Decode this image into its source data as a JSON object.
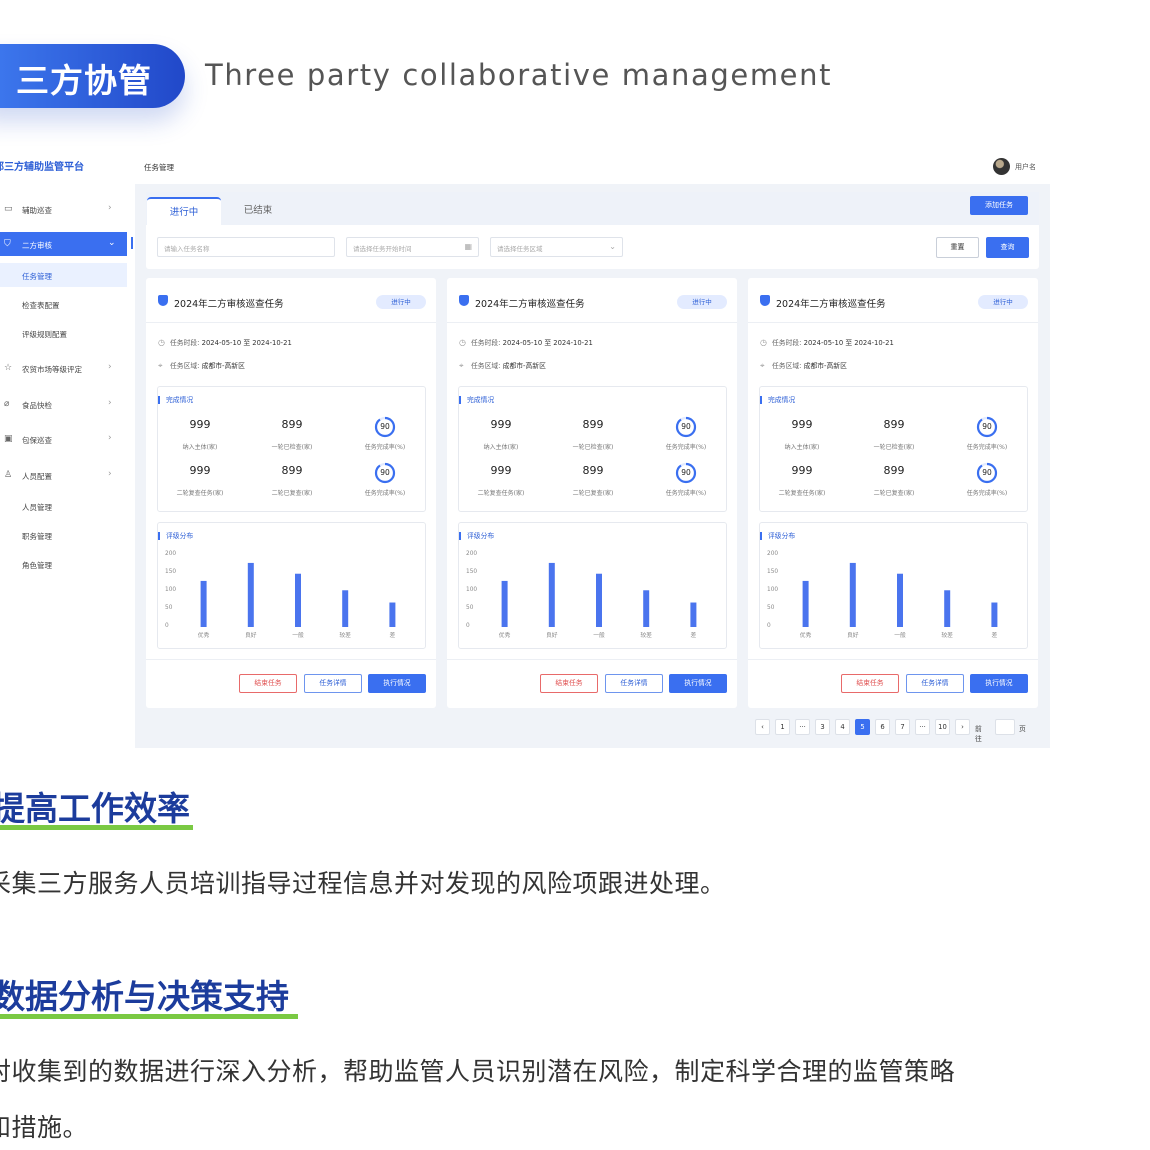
{
  "banner": {
    "title": "三方协管",
    "subtitle": "Three party collaborative management"
  },
  "sidebar": {
    "title": "郭三方辅助监管平台",
    "items": [
      {
        "label": "辅助巡查",
        "icon": "calendar-icon"
      },
      {
        "label": "二方审核",
        "icon": "shield-icon",
        "active": true
      },
      {
        "label": "农贸市场等级评定",
        "icon": "star-icon"
      },
      {
        "label": "食品快检",
        "icon": "flask-icon"
      },
      {
        "label": "包保巡查",
        "icon": "clipboard-icon"
      },
      {
        "label": "人员配置",
        "icon": "user-icon"
      }
    ],
    "sub_review": [
      "任务管理",
      "检查表配置",
      "评级规则配置"
    ],
    "sub_staff": [
      "人员管理",
      "职务管理",
      "角色管理"
    ]
  },
  "topbar": {
    "breadcrumb": "任务管理",
    "username": "用户名"
  },
  "filter": {
    "tabs": [
      "进行中",
      "已结束"
    ],
    "add_button": "添加任务",
    "name_placeholder": "请输入任务名称",
    "date_placeholder": "请选择任务开始时间",
    "region_placeholder": "请选择任务区域",
    "reset_button": "重置",
    "query_button": "查询"
  },
  "cards": [
    {
      "title": "2024年二方审核巡查任务",
      "status": "进行中",
      "period_label": "任务时段:",
      "period_value": "2024-05-10 至 2024-10-21",
      "region_label": "任务区域:",
      "region_value": "成都市-高新区",
      "completion_title": "完成情况",
      "stats": [
        {
          "value": "999",
          "label": "纳入主体(家)"
        },
        {
          "value": "899",
          "label": "一轮已检查(家)"
        },
        {
          "value": "90",
          "label": "任务完成率(%)",
          "ring": 0.9
        },
        {
          "value": "999",
          "label": "二轮复查任务(家)"
        },
        {
          "value": "899",
          "label": "二轮已复查(家)"
        },
        {
          "value": "90",
          "label": "任务完成率(%)",
          "ring": 0.9
        }
      ],
      "rating_title": "评级分布",
      "buttons": [
        "结束任务",
        "任务详情",
        "执行情况"
      ]
    },
    {
      "title": "2024年二方审核巡查任务",
      "status": "进行中",
      "period_label": "任务时段:",
      "period_value": "2024-05-10 至 2024-10-21",
      "region_label": "任务区域:",
      "region_value": "成都市-高新区",
      "completion_title": "完成情况",
      "stats": [
        {
          "value": "999",
          "label": "纳入主体(家)"
        },
        {
          "value": "899",
          "label": "一轮已检查(家)"
        },
        {
          "value": "90",
          "label": "任务完成率(%)",
          "ring": 0.9
        },
        {
          "value": "999",
          "label": "二轮复查任务(家)"
        },
        {
          "value": "899",
          "label": "二轮已复查(家)"
        },
        {
          "value": "90",
          "label": "任务完成率(%)",
          "ring": 0.9
        }
      ],
      "rating_title": "评级分布",
      "buttons": [
        "结束任务",
        "任务详情",
        "执行情况"
      ]
    },
    {
      "title": "2024年二方审核巡查任务",
      "status": "进行中",
      "period_label": "任务时段:",
      "period_value": "2024-05-10 至 2024-10-21",
      "region_label": "任务区域:",
      "region_value": "成都市-高新区",
      "completion_title": "完成情况",
      "stats": [
        {
          "value": "999",
          "label": "纳入主体(家)"
        },
        {
          "value": "899",
          "label": "一轮已检查(家)"
        },
        {
          "value": "90",
          "label": "任务完成率(%)",
          "ring": 0.9
        },
        {
          "value": "999",
          "label": "二轮复查任务(家)"
        },
        {
          "value": "899",
          "label": "二轮已复查(家)"
        },
        {
          "value": "90",
          "label": "任务完成率(%)",
          "ring": 0.9
        }
      ],
      "rating_title": "评级分布",
      "buttons": [
        "结束任务",
        "任务详情",
        "执行情况"
      ]
    }
  ],
  "chart_data": {
    "type": "bar",
    "categories": [
      "优秀",
      "良好",
      "一般",
      "较差",
      "差"
    ],
    "values": [
      128,
      178,
      148,
      102,
      68
    ],
    "ylim": [
      0,
      200
    ],
    "yticks": [
      "200",
      "150",
      "100",
      "50",
      "0"
    ],
    "color": "#4a74ee"
  },
  "pagination": {
    "pages": [
      "1",
      "···",
      "3",
      "4",
      "5",
      "6",
      "7",
      "···",
      "10"
    ],
    "current": "5",
    "goto_label": "前往",
    "page_unit": "页"
  },
  "sections": [
    {
      "title": "提高工作效率",
      "body": [
        "采集三方服务人员培训指导过程信息并对发现的风险项跟进处理。"
      ]
    },
    {
      "title": "数据分析与决策支持",
      "body": [
        "对收集到的数据进行深入分析，帮助监管人员识别潜在风险，制定科学合理的监管策略",
        "和措施。"
      ]
    }
  ],
  "colors": {
    "accent": "#3a6ff0",
    "heading": "#1c3c9c",
    "underline": "#7ac943",
    "danger": "#e05252"
  }
}
